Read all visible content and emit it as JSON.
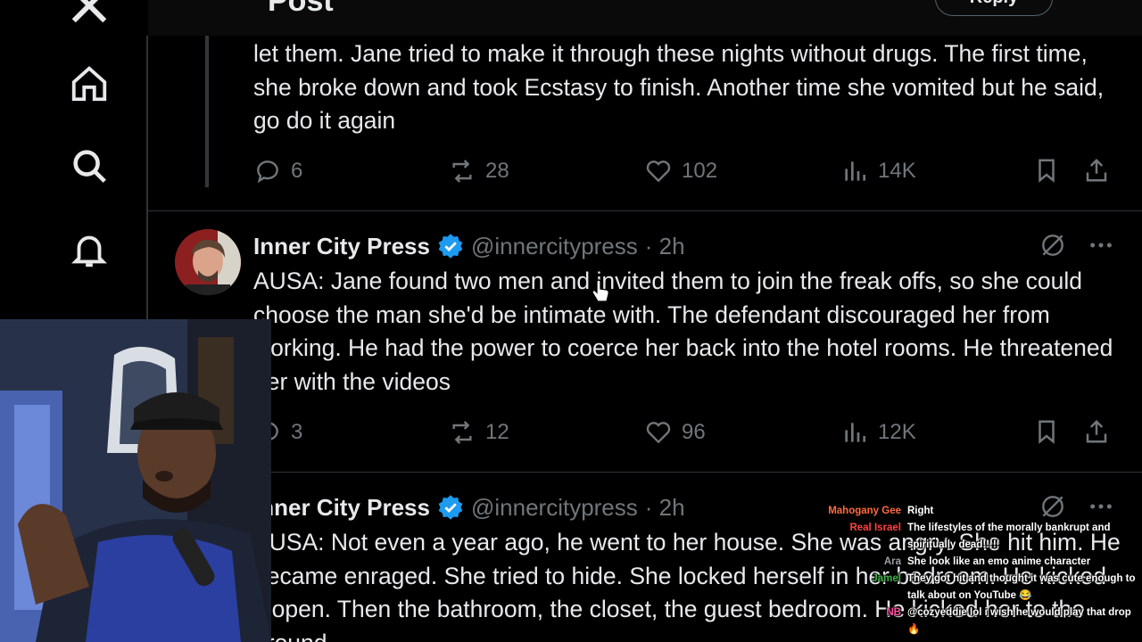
{
  "header": {
    "title": "Post",
    "button_label": "Reply"
  },
  "nav": {
    "items": [
      {
        "icon": "x-logo-icon"
      },
      {
        "icon": "home-icon"
      },
      {
        "icon": "search-icon"
      },
      {
        "icon": "bell-icon"
      }
    ]
  },
  "tweets": [
    {
      "text": "let them. Jane tried to make it through these nights without drugs. The first time, she broke down and took Ecstasy to finish. Another time she vomited but he said, go do it again",
      "replies": "6",
      "reposts": "28",
      "likes": "102",
      "views": "14K"
    },
    {
      "author": "Inner City Press",
      "handle": "@innercitypress",
      "time": "· 2h",
      "text": "AUSA: Jane found two men and invited them to join the freak offs, so she could choose the man she'd be intimate with. The defendant discouraged her from working. He had the power to coerce her back into the hotel rooms. He threatened her with the videos",
      "replies": "3",
      "reposts": "12",
      "likes": "96",
      "views": "12K"
    },
    {
      "author": "Inner City Press",
      "handle": "@innercitypress",
      "time": "· 2h",
      "text": "AUSA: Not even a year ago, he went to her house. She was angry. She hit him. He became enraged. She tried to hide. She locked herself in her bedroom. He kicked it open. Then the bathroom, the closet, the guest bedroom. He kicked her to the ground"
    }
  ],
  "chat": [
    {
      "name": "Mahogany Gee",
      "color": "#ff6b3d",
      "message": "Right"
    },
    {
      "name": "Real Israel",
      "color": "#ff4040",
      "message": "The lifestyles of the morally bankrupt and spiritually dead!!!!!"
    },
    {
      "name": "Ara",
      "color": "#9aa0a6",
      "message": "She look like an emo anime character"
    },
    {
      "name": "Jamel",
      "color": "#3fb24a",
      "message": "They got hit and thought it was cute enough to talk about on YouTube 😂"
    },
    {
      "name": "NB",
      "color": "#ff4fa0",
      "message": "@cozyeddie lol i wish he would play that drop 🔥"
    }
  ],
  "colors": {
    "background": "#000000",
    "verified": "#1d9bf0",
    "muted": "#71767b",
    "text": "#e7e9ea"
  }
}
